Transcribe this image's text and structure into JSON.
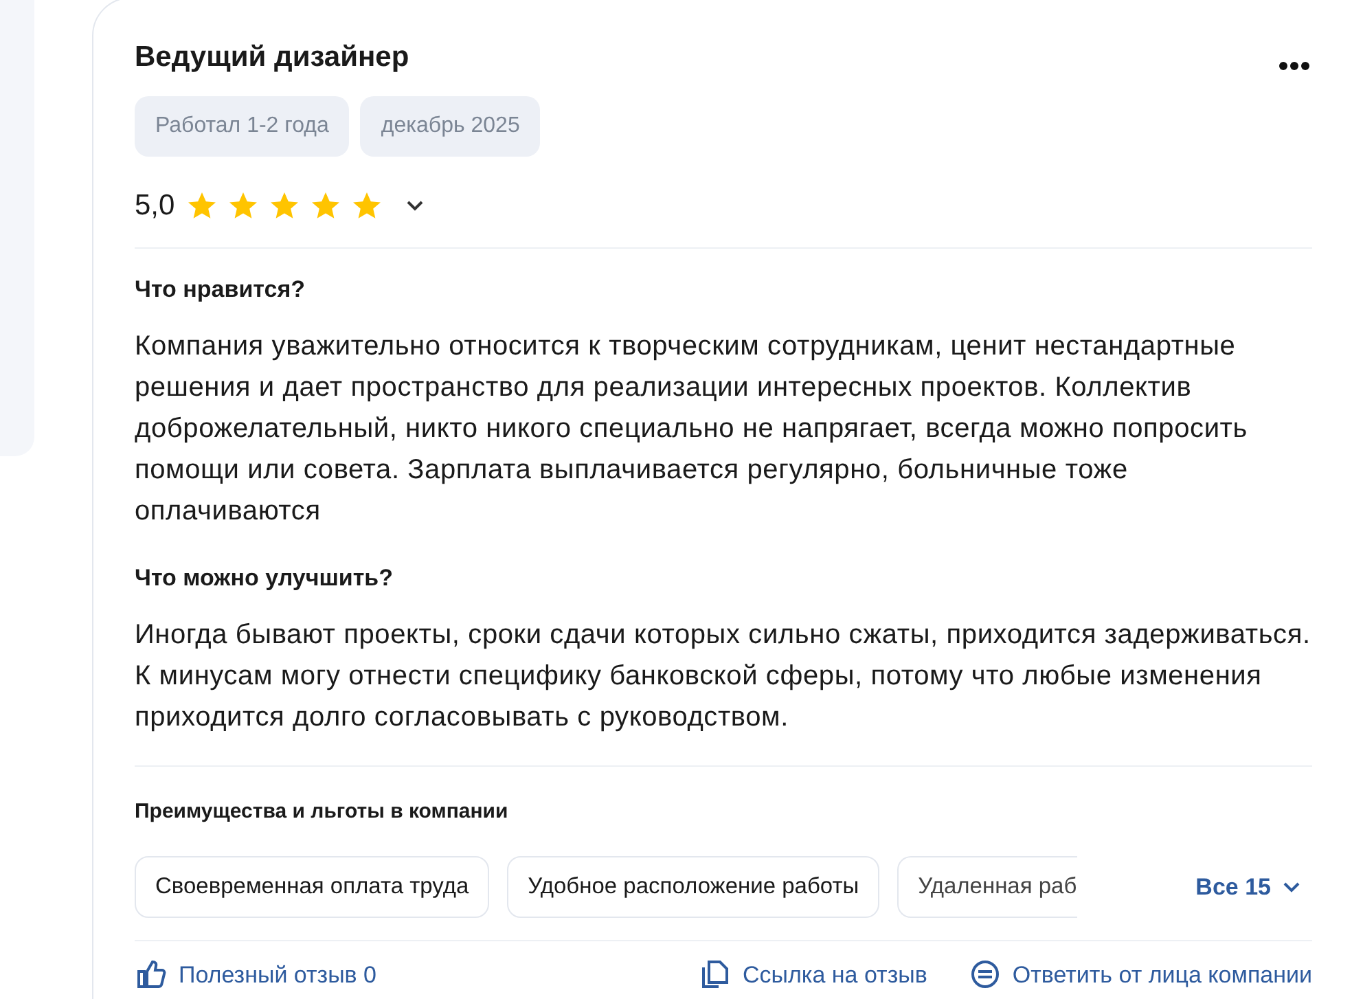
{
  "review": {
    "position": "Ведущий дизайнер",
    "tags": [
      "Работал 1-2 года",
      "декабрь 2025"
    ],
    "rating": "5,0",
    "stars": 5,
    "sections": [
      {
        "title": "Что нравится?",
        "text": "Компания уважительно относится к творческим сотрудникам, ценит нестандартные решения и дает пространство для реализации интересных проектов. Коллектив доброжелательный, никто никого специально не напрягает, всегда можно попросить помощи или совета. Зарплата выплачивается регулярно, больничные тоже оплачиваются"
      },
      {
        "title": "Что можно улучшить?",
        "text": "Иногда бывают проекты, сроки сдачи которых сильно сжаты, приходится задерживаться. К минусам могу отнести специфику банковской сферы, потому что любые изменения приходится долго согласовывать с руководством."
      }
    ],
    "benefits": {
      "title": "Преимущества и льготы в компании",
      "items": [
        {
          "label": "Своевременная оплата труда",
          "faded": false
        },
        {
          "label": "Удобное расположение работы",
          "faded": false
        },
        {
          "label": "Удаленная раб",
          "faded": true
        }
      ],
      "more": "Все 15"
    },
    "actions": [
      {
        "kind": "like",
        "label": "Полезный отзыв 0"
      },
      {
        "kind": "link",
        "label": "Ссылка на отзыв"
      },
      {
        "kind": "reply",
        "label": "Ответить от лица компании"
      }
    ]
  }
}
